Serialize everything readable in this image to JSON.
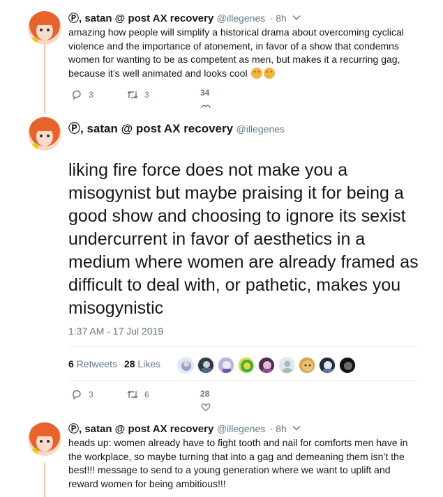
{
  "tweet1": {
    "display_name": "Ⓟ, satan @ post AX recovery",
    "handle": "@illegenes",
    "time": "· 8h",
    "text": "amazing how people will simplify a historical drama about overcoming cyclical violence and the importance of atonement, in favor of a show that condemns women for wanting to be as competent as men, but makes it a recurring gag, because it’s well animated and looks cool",
    "replies": "3",
    "retweets": "3",
    "likes": "34"
  },
  "tweet2": {
    "display_name": "Ⓟ, satan @ post AX recovery",
    "handle": "@illegenes",
    "text": "liking fire force does not make you a misogynist but maybe praising it for being a good show and choosing to ignore its sexist undercurrent in favor of aesthetics in a medium where women are already framed as difficult to deal with, or pathetic, makes you misogynistic",
    "timestamp": "1:37 AM - 17 Jul 2019",
    "retweet_count": "6",
    "retweet_label": "Retweets",
    "like_count": "28",
    "like_label": "Likes",
    "replies": "3",
    "retweets": "6",
    "likes": "28"
  },
  "tweet3": {
    "display_name": "Ⓟ, satan @ post AX recovery",
    "handle": "@illegenes",
    "time": "· 8h",
    "text": "heads up: women already have to fight tooth and nail for comforts men have in the workplace, so maybe turning that into a gag and demeaning them isn’t the best!!! message to send to a young generation where we want to uplift and reward women for being ambitious!!!"
  },
  "colors": {
    "thread_line": "#f5c0aa",
    "secondary_text": "#657786",
    "avatar_hair": "#e8622c"
  }
}
